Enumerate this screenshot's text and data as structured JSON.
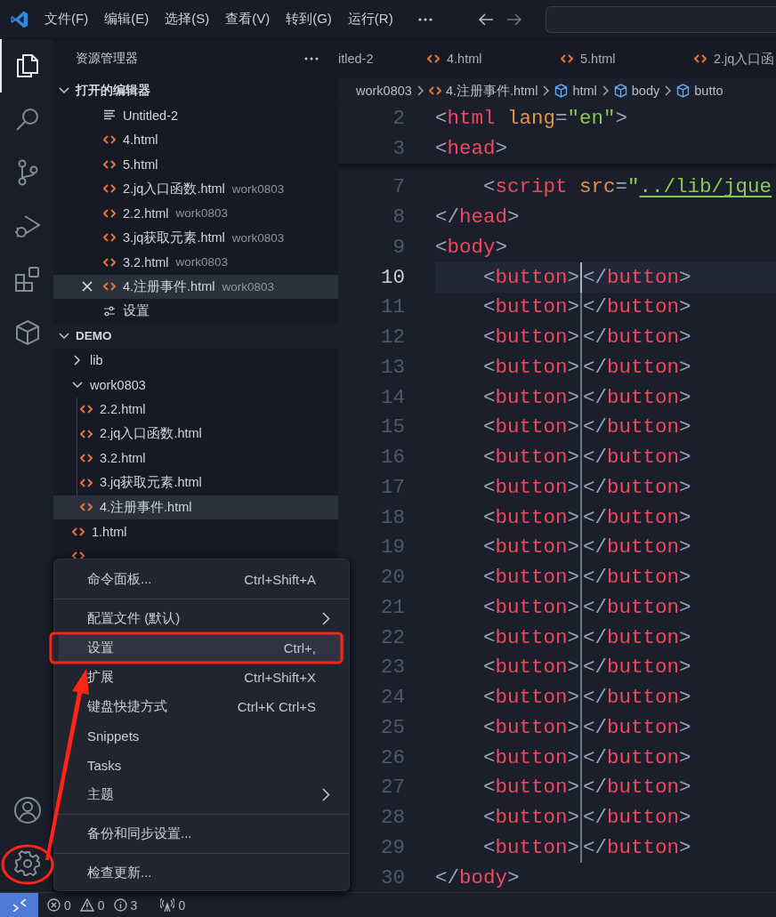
{
  "title_bar": {
    "menus": [
      "文件(F)",
      "编辑(E)",
      "选择(S)",
      "查看(V)",
      "转到(G)",
      "运行(R)"
    ]
  },
  "activity_bar": {
    "top": [
      {
        "kind": "explorer",
        "selected": true
      },
      {
        "kind": "search",
        "selected": false
      },
      {
        "kind": "source_control",
        "selected": false
      },
      {
        "kind": "run",
        "selected": false
      },
      {
        "kind": "extensions",
        "selected": false
      },
      {
        "kind": "cube",
        "selected": false
      }
    ],
    "bottom": [
      {
        "kind": "account"
      },
      {
        "kind": "manage"
      }
    ]
  },
  "sidebar": {
    "title": "资源管理器",
    "open_editors": {
      "title": "打开的编辑器",
      "expanded": true,
      "items": [
        {
          "kind": "text",
          "name": "Untitled-2",
          "selected": false
        },
        {
          "kind": "html",
          "name": "4.html",
          "selected": false
        },
        {
          "kind": "html",
          "name": "5.html",
          "selected": false
        },
        {
          "kind": "html",
          "name": "2.jq入口函数.html",
          "folder": "work0803",
          "selected": false
        },
        {
          "kind": "html",
          "name": "2.2.html",
          "folder": "work0803",
          "selected": false
        },
        {
          "kind": "html",
          "name": "3.jq获取元素.html",
          "folder": "work0803",
          "selected": false
        },
        {
          "kind": "html",
          "name": "3.2.html",
          "folder": "work0803",
          "selected": false
        },
        {
          "kind": "html",
          "name": "4.注册事件.html",
          "folder": "work0803",
          "selected": true
        },
        {
          "kind": "settings",
          "name": "设置",
          "selected": false
        }
      ]
    },
    "folder": {
      "title": "DEMO",
      "expanded": true,
      "children": [
        {
          "kind": "folder",
          "name": "lib",
          "expanded": false,
          "selected": false
        },
        {
          "kind": "folder",
          "name": "work0803",
          "expanded": true,
          "selected": false,
          "children": [
            {
              "kind": "html",
              "name": "2.2.html",
              "selected": false
            },
            {
              "kind": "html",
              "name": "2.jq入口函数.html",
              "selected": false
            },
            {
              "kind": "html",
              "name": "3.2.html",
              "selected": false
            },
            {
              "kind": "html",
              "name": "3.jq获取元素.html",
              "selected": false
            },
            {
              "kind": "html",
              "name": "4.注册事件.html",
              "selected": true
            }
          ]
        },
        {
          "kind": "html",
          "name": "1.html",
          "selected": false
        },
        {
          "kind": "html",
          "selected": false
        }
      ]
    }
  },
  "tabs": [
    {
      "kind": "text",
      "label": "itled-2",
      "selected": false
    },
    {
      "kind": "html",
      "label": "4.html",
      "selected": false
    },
    {
      "kind": "html",
      "label": "5.html",
      "selected": false
    },
    {
      "kind": "html",
      "label": "2.jq入口函",
      "selected": false
    }
  ],
  "breadcrumbs": [
    {
      "kind": "folder",
      "label": "work0803"
    },
    {
      "kind": "html",
      "label": "4.注册事件.html"
    },
    {
      "kind": "element",
      "label": "html"
    },
    {
      "kind": "element",
      "label": "body"
    },
    {
      "kind": "element",
      "label": "butto"
    }
  ],
  "editor": {
    "sticky_lines": [
      {
        "number": "2",
        "tokens": [
          {
            "kind": "punct",
            "text": "<"
          },
          {
            "kind": "tag",
            "text": "html"
          },
          {
            "kind": "attr",
            "text": " lang"
          },
          {
            "kind": "punct",
            "text": "="
          },
          {
            "kind": "string",
            "text": "\"en\""
          },
          {
            "kind": "punct",
            "text": ">"
          }
        ]
      },
      {
        "number": "3",
        "tokens": [
          {
            "kind": "punct",
            "text": "<"
          },
          {
            "kind": "tag",
            "text": "head"
          },
          {
            "kind": "punct",
            "text": ">"
          }
        ]
      }
    ],
    "lines": [
      {
        "number": "7",
        "current": false,
        "tokens": [
          {
            "kind": "punct",
            "text": "    <"
          },
          {
            "kind": "tag",
            "text": "script"
          },
          {
            "kind": "attr",
            "text": " src"
          },
          {
            "kind": "punct",
            "text": "="
          },
          {
            "kind": "string",
            "text": "\""
          },
          {
            "kind": "link",
            "text": "../lib/jque"
          }
        ]
      },
      {
        "number": "8",
        "current": false,
        "tokens": [
          {
            "kind": "punct",
            "text": "</"
          },
          {
            "kind": "tag",
            "text": "head"
          },
          {
            "kind": "punct",
            "text": ">"
          }
        ]
      },
      {
        "number": "9",
        "current": false,
        "tokens": [
          {
            "kind": "punct",
            "text": "<"
          },
          {
            "kind": "tag",
            "text": "body"
          },
          {
            "kind": "punct",
            "text": ">"
          }
        ]
      },
      {
        "number": "10",
        "current": true,
        "tokens": [
          {
            "kind": "punct",
            "text": "    <"
          },
          {
            "kind": "tag",
            "text": "button"
          },
          {
            "kind": "punct",
            "text": ">",
            "caret_after": true
          },
          {
            "kind": "punct",
            "text": "</"
          },
          {
            "kind": "tag",
            "text": "button"
          },
          {
            "kind": "punct",
            "text": ">"
          }
        ]
      },
      {
        "number": "11",
        "current": false,
        "tokens": [
          {
            "kind": "punct",
            "text": "    <"
          },
          {
            "kind": "tag",
            "text": "button"
          },
          {
            "kind": "punct",
            "text": ">",
            "caret_after": true
          },
          {
            "kind": "punct",
            "text": "</"
          },
          {
            "kind": "tag",
            "text": "button"
          },
          {
            "kind": "punct",
            "text": ">"
          }
        ]
      },
      {
        "number": "12",
        "current": false,
        "tokens": [
          {
            "kind": "punct",
            "text": "    <"
          },
          {
            "kind": "tag",
            "text": "button"
          },
          {
            "kind": "punct",
            "text": ">",
            "caret_after": true
          },
          {
            "kind": "punct",
            "text": "</"
          },
          {
            "kind": "tag",
            "text": "button"
          },
          {
            "kind": "punct",
            "text": ">"
          }
        ]
      },
      {
        "number": "13",
        "current": false,
        "tokens": [
          {
            "kind": "punct",
            "text": "    <"
          },
          {
            "kind": "tag",
            "text": "button"
          },
          {
            "kind": "punct",
            "text": ">",
            "caret_after": true
          },
          {
            "kind": "punct",
            "text": "</"
          },
          {
            "kind": "tag",
            "text": "button"
          },
          {
            "kind": "punct",
            "text": ">"
          }
        ]
      },
      {
        "number": "14",
        "current": false,
        "tokens": [
          {
            "kind": "punct",
            "text": "    <"
          },
          {
            "kind": "tag",
            "text": "button"
          },
          {
            "kind": "punct",
            "text": ">",
            "caret_after": true
          },
          {
            "kind": "punct",
            "text": "</"
          },
          {
            "kind": "tag",
            "text": "button"
          },
          {
            "kind": "punct",
            "text": ">"
          }
        ]
      },
      {
        "number": "15",
        "current": false,
        "tokens": [
          {
            "kind": "punct",
            "text": "    <"
          },
          {
            "kind": "tag",
            "text": "button"
          },
          {
            "kind": "punct",
            "text": ">",
            "caret_after": true
          },
          {
            "kind": "punct",
            "text": "</"
          },
          {
            "kind": "tag",
            "text": "button"
          },
          {
            "kind": "punct",
            "text": ">"
          }
        ]
      },
      {
        "number": "16",
        "current": false,
        "tokens": [
          {
            "kind": "punct",
            "text": "    <"
          },
          {
            "kind": "tag",
            "text": "button"
          },
          {
            "kind": "punct",
            "text": ">",
            "caret_after": true
          },
          {
            "kind": "punct",
            "text": "</"
          },
          {
            "kind": "tag",
            "text": "button"
          },
          {
            "kind": "punct",
            "text": ">"
          }
        ]
      },
      {
        "number": "17",
        "current": false,
        "tokens": [
          {
            "kind": "punct",
            "text": "    <"
          },
          {
            "kind": "tag",
            "text": "button"
          },
          {
            "kind": "punct",
            "text": ">",
            "caret_after": true
          },
          {
            "kind": "punct",
            "text": "</"
          },
          {
            "kind": "tag",
            "text": "button"
          },
          {
            "kind": "punct",
            "text": ">"
          }
        ]
      },
      {
        "number": "18",
        "current": false,
        "tokens": [
          {
            "kind": "punct",
            "text": "    <"
          },
          {
            "kind": "tag",
            "text": "button"
          },
          {
            "kind": "punct",
            "text": ">",
            "caret_after": true
          },
          {
            "kind": "punct",
            "text": "</"
          },
          {
            "kind": "tag",
            "text": "button"
          },
          {
            "kind": "punct",
            "text": ">"
          }
        ]
      },
      {
        "number": "19",
        "current": false,
        "tokens": [
          {
            "kind": "punct",
            "text": "    <"
          },
          {
            "kind": "tag",
            "text": "button"
          },
          {
            "kind": "punct",
            "text": ">",
            "caret_after": true
          },
          {
            "kind": "punct",
            "text": "</"
          },
          {
            "kind": "tag",
            "text": "button"
          },
          {
            "kind": "punct",
            "text": ">"
          }
        ]
      },
      {
        "number": "20",
        "current": false,
        "tokens": [
          {
            "kind": "punct",
            "text": "    <"
          },
          {
            "kind": "tag",
            "text": "button"
          },
          {
            "kind": "punct",
            "text": ">",
            "caret_after": true
          },
          {
            "kind": "punct",
            "text": "</"
          },
          {
            "kind": "tag",
            "text": "button"
          },
          {
            "kind": "punct",
            "text": ">"
          }
        ]
      },
      {
        "number": "21",
        "current": false,
        "tokens": [
          {
            "kind": "punct",
            "text": "    <"
          },
          {
            "kind": "tag",
            "text": "button"
          },
          {
            "kind": "punct",
            "text": ">",
            "caret_after": true
          },
          {
            "kind": "punct",
            "text": "</"
          },
          {
            "kind": "tag",
            "text": "button"
          },
          {
            "kind": "punct",
            "text": ">"
          }
        ]
      },
      {
        "number": "22",
        "current": false,
        "tokens": [
          {
            "kind": "punct",
            "text": "    <"
          },
          {
            "kind": "tag",
            "text": "button"
          },
          {
            "kind": "punct",
            "text": ">",
            "caret_after": true
          },
          {
            "kind": "punct",
            "text": "</"
          },
          {
            "kind": "tag",
            "text": "button"
          },
          {
            "kind": "punct",
            "text": ">"
          }
        ]
      },
      {
        "number": "23",
        "current": false,
        "tokens": [
          {
            "kind": "punct",
            "text": "    <"
          },
          {
            "kind": "tag",
            "text": "button"
          },
          {
            "kind": "punct",
            "text": ">",
            "caret_after": true
          },
          {
            "kind": "punct",
            "text": "</"
          },
          {
            "kind": "tag",
            "text": "button"
          },
          {
            "kind": "punct",
            "text": ">"
          }
        ]
      },
      {
        "number": "24",
        "current": false,
        "tokens": [
          {
            "kind": "punct",
            "text": "    <"
          },
          {
            "kind": "tag",
            "text": "button"
          },
          {
            "kind": "punct",
            "text": ">",
            "caret_after": true
          },
          {
            "kind": "punct",
            "text": "</"
          },
          {
            "kind": "tag",
            "text": "button"
          },
          {
            "kind": "punct",
            "text": ">"
          }
        ]
      },
      {
        "number": "25",
        "current": false,
        "tokens": [
          {
            "kind": "punct",
            "text": "    <"
          },
          {
            "kind": "tag",
            "text": "button"
          },
          {
            "kind": "punct",
            "text": ">",
            "caret_after": true
          },
          {
            "kind": "punct",
            "text": "</"
          },
          {
            "kind": "tag",
            "text": "button"
          },
          {
            "kind": "punct",
            "text": ">"
          }
        ]
      },
      {
        "number": "26",
        "current": false,
        "tokens": [
          {
            "kind": "punct",
            "text": "    <"
          },
          {
            "kind": "tag",
            "text": "button"
          },
          {
            "kind": "punct",
            "text": ">",
            "caret_after": true
          },
          {
            "kind": "punct",
            "text": "</"
          },
          {
            "kind": "tag",
            "text": "button"
          },
          {
            "kind": "punct",
            "text": ">"
          }
        ]
      },
      {
        "number": "27",
        "current": false,
        "tokens": [
          {
            "kind": "punct",
            "text": "    <"
          },
          {
            "kind": "tag",
            "text": "button"
          },
          {
            "kind": "punct",
            "text": ">",
            "caret_after": true
          },
          {
            "kind": "punct",
            "text": "</"
          },
          {
            "kind": "tag",
            "text": "button"
          },
          {
            "kind": "punct",
            "text": ">"
          }
        ]
      },
      {
        "number": "28",
        "current": false,
        "tokens": [
          {
            "kind": "punct",
            "text": "    <"
          },
          {
            "kind": "tag",
            "text": "button"
          },
          {
            "kind": "punct",
            "text": ">",
            "caret_after": true
          },
          {
            "kind": "punct",
            "text": "</"
          },
          {
            "kind": "tag",
            "text": "button"
          },
          {
            "kind": "punct",
            "text": ">"
          }
        ]
      },
      {
        "number": "29",
        "current": false,
        "tokens": [
          {
            "kind": "punct",
            "text": "    <"
          },
          {
            "kind": "tag",
            "text": "button"
          },
          {
            "kind": "punct",
            "text": ">",
            "caret_after": true
          },
          {
            "kind": "punct",
            "text": "</"
          },
          {
            "kind": "tag",
            "text": "button"
          },
          {
            "kind": "punct",
            "text": ">"
          }
        ]
      },
      {
        "number": "30",
        "current": false,
        "tokens": [
          {
            "kind": "punct",
            "text": "</"
          },
          {
            "kind": "tag",
            "text": "body"
          },
          {
            "kind": "punct",
            "text": ">"
          }
        ]
      }
    ]
  },
  "manage_menu": {
    "items": [
      {
        "kind": "command",
        "label": "命令面板...",
        "shortcut": "Ctrl+Shift+A",
        "selected": false
      },
      {
        "kind": "separator"
      },
      {
        "kind": "submenu",
        "label": "配置文件 (默认)",
        "selected": false
      },
      {
        "kind": "command",
        "label": "设置",
        "shortcut": "Ctrl+,",
        "selected": true
      },
      {
        "kind": "command",
        "label": "扩展",
        "shortcut": "Ctrl+Shift+X",
        "selected": false
      },
      {
        "kind": "command",
        "label": "键盘快捷方式",
        "shortcut": "Ctrl+K Ctrl+S",
        "selected": false
      },
      {
        "kind": "command",
        "label": "Snippets",
        "selected": false
      },
      {
        "kind": "command",
        "label": "Tasks",
        "selected": false
      },
      {
        "kind": "submenu",
        "label": "主题",
        "selected": false
      },
      {
        "kind": "separator"
      },
      {
        "kind": "command",
        "label": "备份和同步设置...",
        "selected": false
      },
      {
        "kind": "separator"
      },
      {
        "kind": "command",
        "label": "检查更新...",
        "selected": false
      }
    ]
  },
  "status_bar": {
    "errors": "0",
    "warnings": "0",
    "infos": "3",
    "ports": "0"
  }
}
